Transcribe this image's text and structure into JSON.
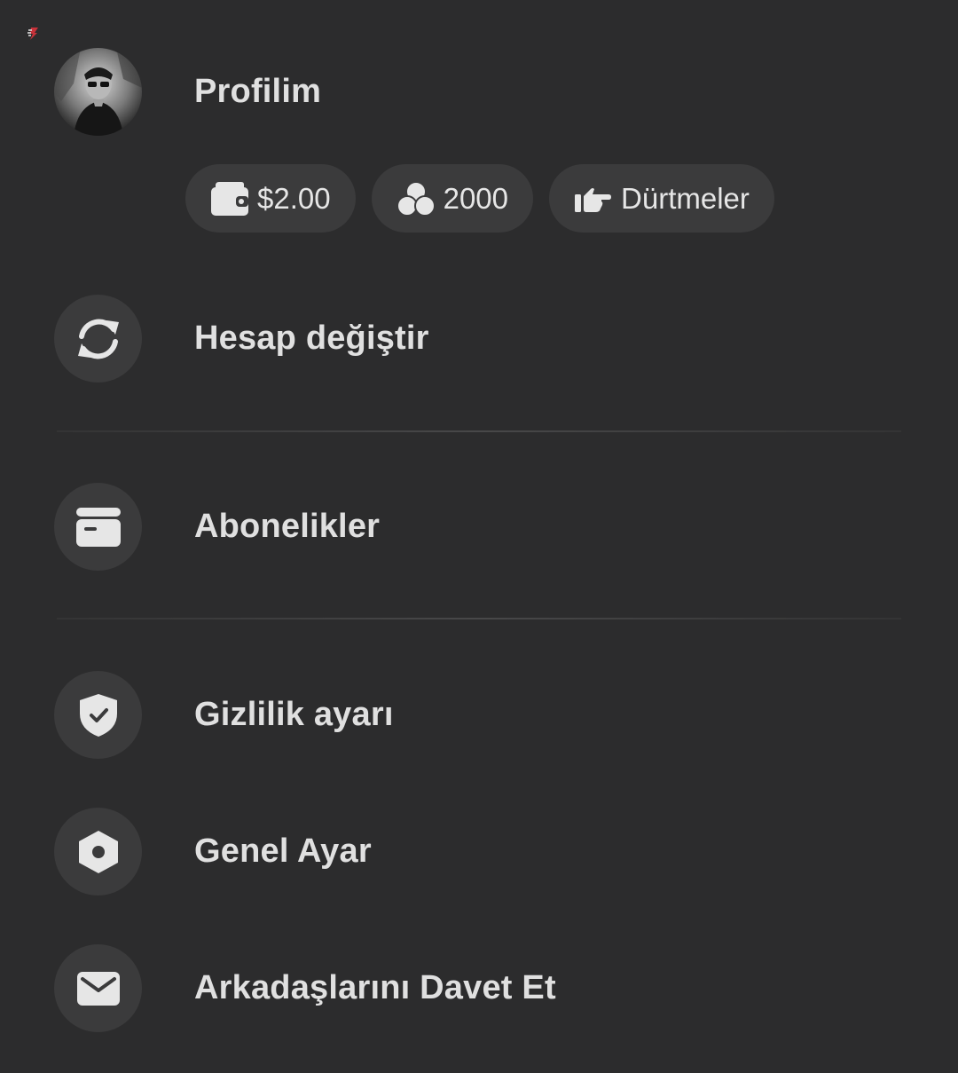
{
  "profile": {
    "title": "Profilim"
  },
  "chips": {
    "wallet": "$2.00",
    "coins": "2000",
    "pokes": "Dürtmeler"
  },
  "menu": {
    "switch_account": "Hesap değiştir",
    "subscriptions": "Abonelikler",
    "privacy": "Gizlilik ayarı",
    "general": "Genel Ayar",
    "invite": "Arkadaşlarını Davet Et"
  },
  "colors": {
    "background": "#2c2c2d",
    "circle": "#3b3b3c",
    "icon": "#e6e6e6",
    "text": "#e0e0e0"
  }
}
